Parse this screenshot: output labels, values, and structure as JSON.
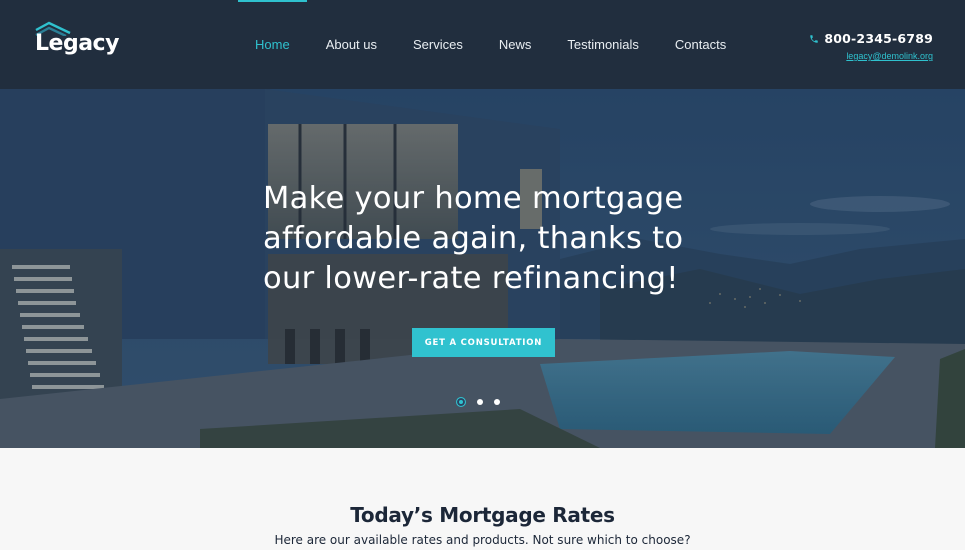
{
  "header": {
    "logo_text": "Legacy",
    "nav": [
      {
        "label": "Home",
        "active": true
      },
      {
        "label": "About us",
        "active": false
      },
      {
        "label": "Services",
        "active": false
      },
      {
        "label": "News",
        "active": false
      },
      {
        "label": "Testimonials",
        "active": false
      },
      {
        "label": "Contacts",
        "active": false
      }
    ],
    "phone": "800-2345-6789",
    "email": "legacy@demolink.org"
  },
  "hero": {
    "title": "Make your home mortgage affordable again, thanks to our lower-rate refinancing!",
    "cta_label": "GET A CONSULTATION",
    "slides": {
      "count": 3,
      "active_index": 0
    }
  },
  "rates": {
    "title": "Today’s Mortgage Rates",
    "subtitle": "Here are our available rates and products. Not sure which to choose?"
  },
  "colors": {
    "header_bg": "#212e3e",
    "accent": "#2fc1ce",
    "text_dark": "#1c2738",
    "section_bg": "#f7f7f7"
  }
}
